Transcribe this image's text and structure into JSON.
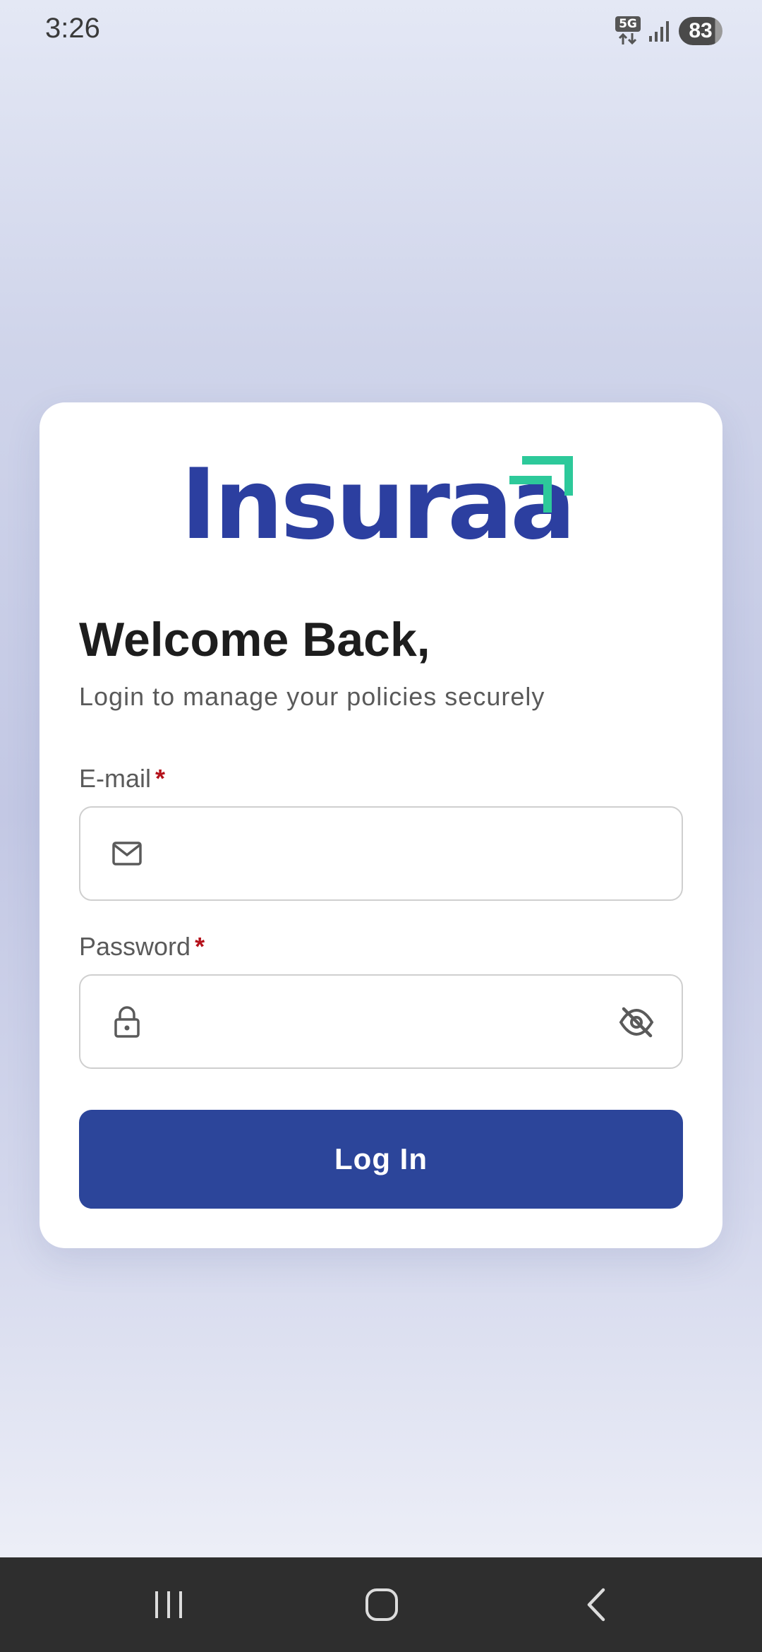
{
  "status_bar": {
    "time": "3:26",
    "network_type": "5G",
    "battery_level": "83",
    "icons": [
      "network-5g-icon",
      "signal-icon",
      "battery-icon"
    ]
  },
  "logo": {
    "text": "Insuraa",
    "text_color": "#2c3fa0",
    "accent_color": "#2dc99a",
    "icon": "double-arrow-up-right-icon"
  },
  "login": {
    "title": "Welcome Back,",
    "subtitle": "Login to manage your policies securely",
    "email": {
      "label": "E-mail",
      "required_mark": "*",
      "value": "",
      "placeholder": "",
      "icon": "mail-icon"
    },
    "password": {
      "label": "Password",
      "required_mark": "*",
      "value": "",
      "placeholder": "",
      "icon": "lock-icon",
      "toggle_icon": "eye-off-icon"
    },
    "submit_label": "Log In",
    "button_color": "#2c459a"
  },
  "nav_bar": {
    "icons": [
      "recent-apps-icon",
      "home-icon",
      "back-icon"
    ]
  }
}
